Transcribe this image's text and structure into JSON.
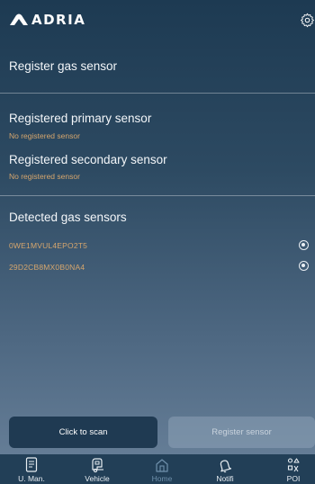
{
  "header": {
    "brand": "ADRIA",
    "settings_icon": "gear-icon"
  },
  "register_section": {
    "title": "Register gas sensor"
  },
  "registered": {
    "primary_title": "Registered primary sensor",
    "primary_value": "No registered sensor",
    "secondary_title": "Registered secondary sensor",
    "secondary_value": "No registered sensor"
  },
  "detected": {
    "title": "Detected gas sensors",
    "sensors": [
      {
        "id": "0WE1MVUL4EPO2T5"
      },
      {
        "id": "29D2CB8MX0B0NA4"
      }
    ]
  },
  "actions": {
    "scan_label": "Click to scan",
    "register_label": "Register sensor"
  },
  "tabbar": {
    "tabs": [
      {
        "label": "U. Man.",
        "icon": "manual-icon"
      },
      {
        "label": "Vehicle",
        "icon": "vehicle-icon"
      },
      {
        "label": "Home",
        "icon": "home-icon",
        "active": true
      },
      {
        "label": "Notifi",
        "icon": "bell-icon"
      },
      {
        "label": "POI",
        "icon": "poi-icon"
      }
    ]
  },
  "colors": {
    "accent_orange": "#d6a66d",
    "scan_button": "#1f3a52",
    "tabbar": "#223f57"
  }
}
